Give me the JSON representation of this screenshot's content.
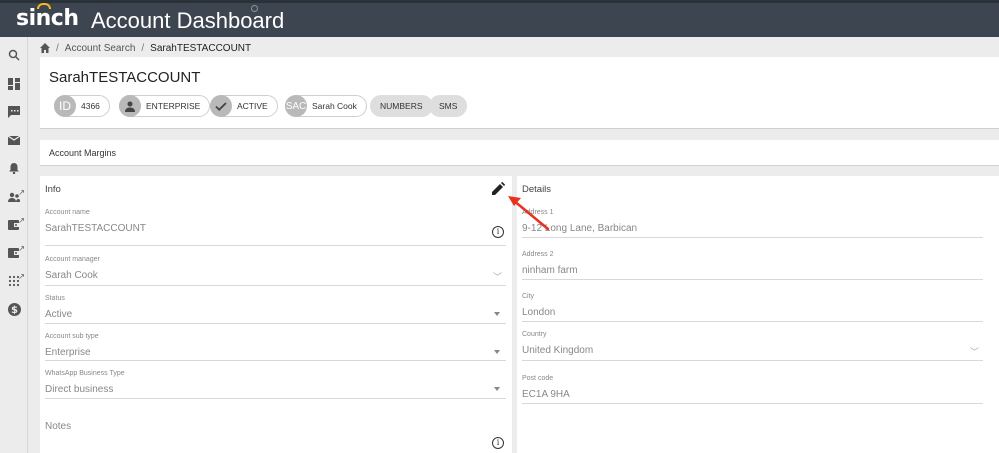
{
  "header": {
    "logo": "sinch",
    "title": "Account Dashboard"
  },
  "sidenav": {
    "items": [
      "search-icon",
      "dashboard-icon",
      "message-icon",
      "mail-icon",
      "bell-icon",
      "users-icon",
      "wallet-icon",
      "wallet-icon",
      "dialpad-icon",
      "dollar-icon"
    ]
  },
  "breadcrumb": {
    "link": "Account Search",
    "separator": "/",
    "current": "SarahTESTACCOUNT"
  },
  "account": {
    "name": "SarahTESTACCOUNT",
    "chips": {
      "id_avatar": "ID",
      "id_value": "4366",
      "type": "ENTERPRISE",
      "status": "ACTIVE",
      "manager_avatar": "SAC",
      "manager": "Sarah Cook",
      "numbers": "NUMBERS",
      "sms": "SMS"
    }
  },
  "margins": {
    "label": "Account Margins"
  },
  "info": {
    "title": "Info",
    "account_name_label": "Account name",
    "account_name_value": "SarahTESTACCOUNT",
    "account_manager_label": "Account manager",
    "account_manager_value": "Sarah Cook",
    "status_label": "Status",
    "status_value": "Active",
    "sub_type_label": "Account sub type",
    "sub_type_value": "Enterprise",
    "whatsapp_label": "WhatsApp Business Type",
    "whatsapp_value": "Direct business",
    "notes_label": "Notes"
  },
  "details": {
    "title": "Details",
    "address1_label": "Address 1",
    "address1_value": "9-12 Long Lane, Barbican",
    "address2_label": "Address 2",
    "address2_value": "ninham farm",
    "city_label": "City",
    "city_value": "London",
    "country_label": "Country",
    "country_value": "United Kingdom",
    "postcode_label": "Post code",
    "postcode_value": "EC1A 9HA"
  },
  "colors": {
    "topbar": "#3d4650",
    "brand_accent": "#f7b81a",
    "annotation_arrow": "#e8321e"
  }
}
